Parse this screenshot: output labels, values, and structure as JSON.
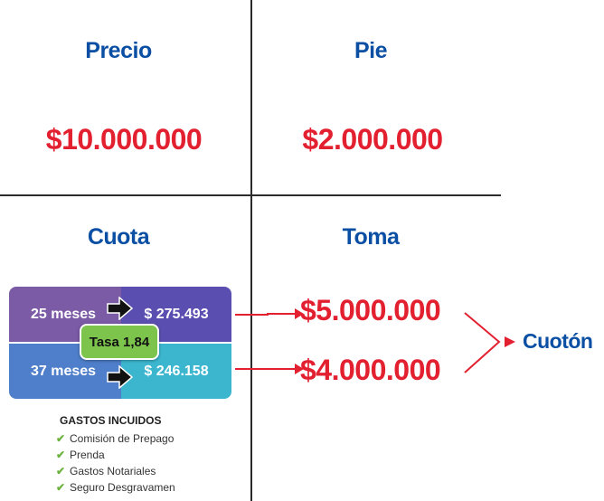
{
  "sections": {
    "precio": {
      "label": "Precio",
      "value": "$10.000.000"
    },
    "pie": {
      "label": "Pie",
      "value": "$2.000.000"
    },
    "cuota": {
      "label": "Cuota"
    },
    "toma": {
      "label": "Toma"
    }
  },
  "plans": [
    {
      "term": "25 meses",
      "payment": "$ 275.493",
      "toma": "$5.000.000"
    },
    {
      "term": "37 meses",
      "payment": "$ 246.158",
      "toma": "$4.000.000"
    }
  ],
  "tasa": "Tasa 1,84",
  "cuoton": "Cuotón",
  "gastos": {
    "title": "GASTOS INCUIDOS",
    "items": [
      "Comisión de Prepago",
      "Prenda",
      "Gastos Notariales",
      "Seguro Desgravamen"
    ]
  },
  "colors": {
    "heading": "#0a4fa3",
    "amount": "#e32030",
    "purple": "#7b5aa6",
    "indigo": "#5a4fb0",
    "blue": "#4f7fca",
    "teal": "#3cb6cf",
    "tasa_green": "#7dc44d",
    "check_green": "#6cb33f"
  }
}
